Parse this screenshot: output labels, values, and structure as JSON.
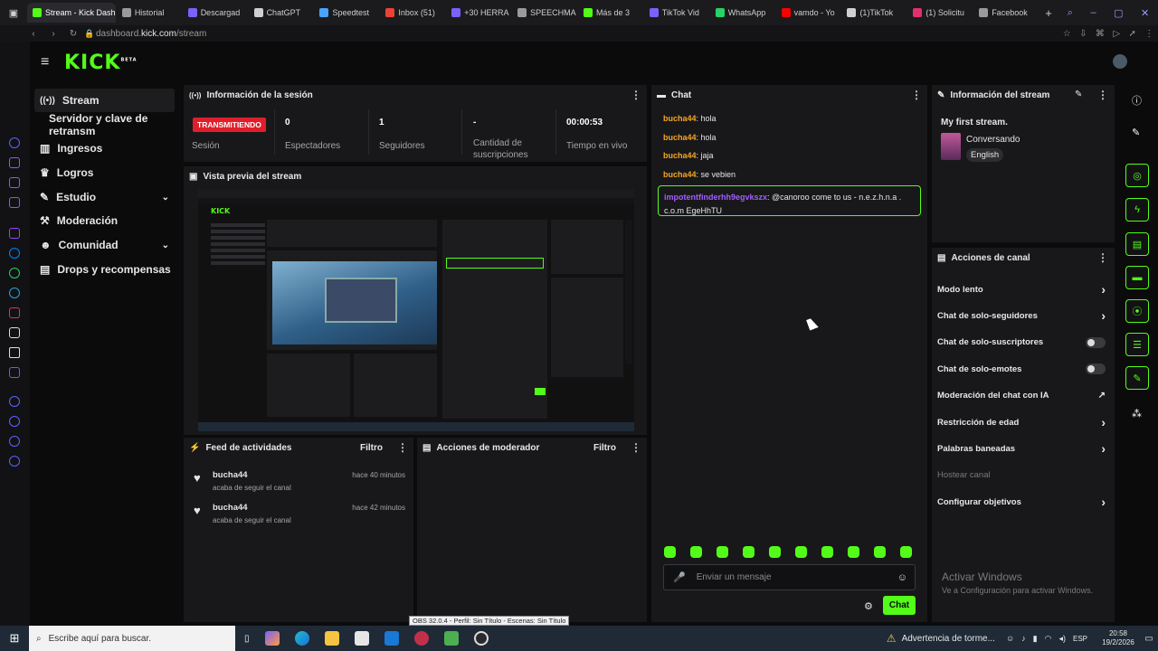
{
  "browser": {
    "tabs": [
      {
        "label": "Stream - Kick Dashb",
        "color": "#53fc18",
        "active": true
      },
      {
        "label": "Historial",
        "color": "#9a9a9a"
      },
      {
        "label": "Descargad",
        "color": "#7b61ff"
      },
      {
        "label": "ChatGPT",
        "color": "#cfcfcf"
      },
      {
        "label": "Speedtest",
        "color": "#4aa3ff"
      },
      {
        "label": "Inbox (51)",
        "color": "#ea4335"
      },
      {
        "label": "+30 HERRA",
        "color": "#7b61ff"
      },
      {
        "label": "SPEECHMA",
        "color": "#9a9a9a"
      },
      {
        "label": "Más de 3",
        "color": "#53fc18"
      },
      {
        "label": "TikTok Vid",
        "color": "#7b61ff"
      },
      {
        "label": "WhatsApp",
        "color": "#25d366"
      },
      {
        "label": "vamdo - Yo",
        "color": "#ff0000"
      },
      {
        "label": "(1)TikTok",
        "color": "#cfcfcf"
      },
      {
        "label": "(1) Solicitu",
        "color": "#e1306c"
      },
      {
        "label": "Facebook",
        "color": "#9a9a9a"
      }
    ],
    "url_host": "dashboard.",
    "url_domain": "kick.com",
    "url_path": "/stream"
  },
  "logo": {
    "text": "KICK",
    "beta": "BETA"
  },
  "sidebar": {
    "items": [
      {
        "label": "Stream",
        "icon": "stream-icon"
      },
      {
        "label": "Servidor y clave de retransm",
        "icon": ""
      },
      {
        "label": "Ingresos",
        "icon": "chart-icon"
      },
      {
        "label": "Logros",
        "icon": "trophy-icon"
      },
      {
        "label": "Estudio",
        "icon": "paint-icon"
      },
      {
        "label": "Moderación",
        "icon": "hammer-icon"
      },
      {
        "label": "Comunidad",
        "icon": "users-icon"
      },
      {
        "label": "Drops y recompensas",
        "icon": "gift-icon"
      }
    ]
  },
  "session": {
    "title": "Información de la sesión",
    "status": "TRANSMITIENDO",
    "status_label": "Sesión",
    "stats": [
      {
        "value": "0",
        "label": "Espectadores"
      },
      {
        "value": "1",
        "label": "Seguidores"
      },
      {
        "value": "-",
        "label": "Cantidad de suscripciones"
      },
      {
        "value": "00:00:53",
        "label": "Tiempo en vivo"
      }
    ]
  },
  "preview": {
    "title": "Vista previa del stream"
  },
  "feed": {
    "title": "Feed de actividades",
    "filter": "Filtro",
    "items": [
      {
        "user": "bucha44",
        "text": "acaba de seguir el canal",
        "time": "hace 40 minutos"
      },
      {
        "user": "bucha44",
        "text": "acaba de seguir el canal",
        "time": "hace 42 minutos"
      }
    ]
  },
  "modactions": {
    "title": "Acciones de moderador",
    "filter": "Filtro"
  },
  "chat": {
    "title": "Chat",
    "messages": [
      {
        "user": "bucha44",
        "text": ": hola"
      },
      {
        "user": "bucha44",
        "text": ": hola"
      },
      {
        "user": "bucha44",
        "text": ": jaja"
      },
      {
        "user": "bucha44",
        "text": ": se vebien"
      }
    ],
    "highlight": {
      "user": "impotentfinderhh9egvkszx",
      "text": ": @canoroo come to us - n.e.z.h.n.a . c.o.m EgeHhTU"
    },
    "input_placeholder": "Enviar un mensaje",
    "send_label": "Chat"
  },
  "stream_info": {
    "title": "Información del stream",
    "stream_title": "My first stream.",
    "category": "Conversando",
    "language": "English"
  },
  "channel_actions": {
    "title": "Acciones de canal",
    "items": [
      {
        "label": "Modo lento",
        "control": "chevron"
      },
      {
        "label": "Chat de solo-seguidores",
        "control": "chevron"
      },
      {
        "label": "Chat de solo-suscriptores",
        "control": "toggle"
      },
      {
        "label": "Chat de solo-emotes",
        "control": "toggle"
      },
      {
        "label": "Moderación del chat con IA",
        "control": "external"
      },
      {
        "label": "Restricción de edad",
        "control": "chevron"
      },
      {
        "label": "Palabras baneadas",
        "control": "chevron"
      },
      {
        "label": "Hostear canal",
        "control": "none",
        "disabled": true
      },
      {
        "label": "Configurar objetivos",
        "control": "chevron"
      }
    ]
  },
  "watermark": {
    "line1": "Activar Windows",
    "line2": "Ve a Configuración para activar Windows."
  },
  "taskbar": {
    "search_placeholder": "Escribe aquí para buscar.",
    "tooltip": "OBS 32.0.4 - Perfil: Sin Título - Escenas: Sin Título",
    "weather": "Advertencia de torme...",
    "lang": "ESP",
    "time": "20:58",
    "date": "19/2/2026"
  },
  "colors": {
    "accent": "#53fc18",
    "live": "#e01e2b",
    "panel": "#18181b",
    "bg": "#0b0b0c"
  }
}
